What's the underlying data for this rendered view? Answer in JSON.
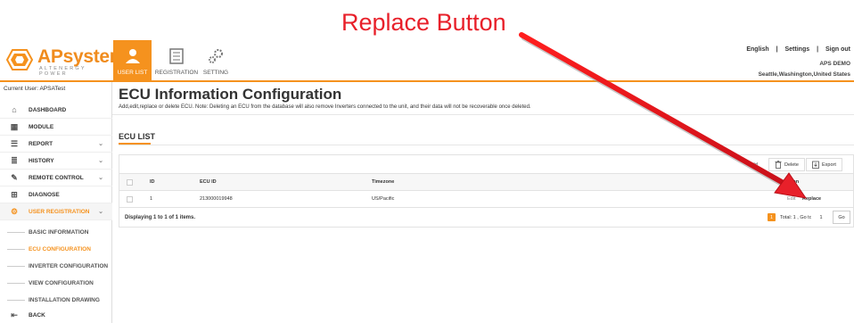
{
  "annotation": {
    "title": "Replace Button"
  },
  "brand": {
    "name": "APsystems",
    "tagline": "ALTENERGY POWER"
  },
  "nav": {
    "tabs": [
      {
        "label": "USER LIST",
        "icon": "user-list-icon",
        "active": true
      },
      {
        "label": "REGISTRATION",
        "icon": "registration-icon",
        "active": false
      },
      {
        "label": "SETTING",
        "icon": "setting-gears-icon",
        "active": false
      }
    ]
  },
  "header": {
    "language": "English",
    "settings": "Settings",
    "signout": "Sign out",
    "separator": "|",
    "user": "APS DEMO",
    "location": "Seattle,Washington,United States"
  },
  "sidebar": {
    "current_user": "Current User: APSATest",
    "items": [
      {
        "label": "DASHBOARD",
        "icon": "home-icon"
      },
      {
        "label": "MODULE",
        "icon": "grid-icon"
      },
      {
        "label": "REPORT",
        "icon": "report-icon",
        "chevron": "⌄"
      },
      {
        "label": "HISTORY",
        "icon": "database-icon",
        "chevron": "⌄"
      },
      {
        "label": "REMOTE CONTROL",
        "icon": "wrench-icon",
        "chevron": "⌄"
      },
      {
        "label": "DIAGNOSE",
        "icon": "diagnose-icon"
      },
      {
        "label": "USER REGISTRATION",
        "icon": "gears-icon",
        "chevron": "⌄",
        "active": true
      }
    ],
    "sub_items": [
      {
        "label": "BASIC INFORMATION"
      },
      {
        "label": "ECU CONFIGURATION",
        "active": true
      },
      {
        "label": "INVERTER CONFIGURATION"
      },
      {
        "label": "VIEW CONFIGURATION"
      },
      {
        "label": "INSTALLATION DRAWING"
      }
    ],
    "back": {
      "label": "BACK",
      "icon": "back-icon"
    }
  },
  "main": {
    "title": "ECU Information Configuration",
    "description": "Add,edit,replace or delete ECU. Note: Deleting an ECU from the database will also remove Inverters connected to the unit, and their data will not be recoverable once deleted.",
    "section_title": "ECU LIST",
    "toolbar": {
      "add": "Add",
      "delete": "Delete",
      "export": "Export"
    },
    "table": {
      "columns": [
        "ID",
        "ECU ID",
        "Timezone",
        "Action"
      ],
      "visible_action_header": "tion",
      "rows": [
        {
          "id": "1",
          "ecu_id": "213000019948",
          "timezone": "US/Pacific",
          "edit": "Edit",
          "replace": "Replace"
        }
      ]
    },
    "footer": {
      "displaying": "Displaying 1 to 1 of 1 items.",
      "page": "1",
      "total": "Total: 1 , Go to",
      "goto_value": "1",
      "go": "Go"
    }
  },
  "colors": {
    "accent": "#f5921e",
    "annotation": "#e8202a"
  }
}
